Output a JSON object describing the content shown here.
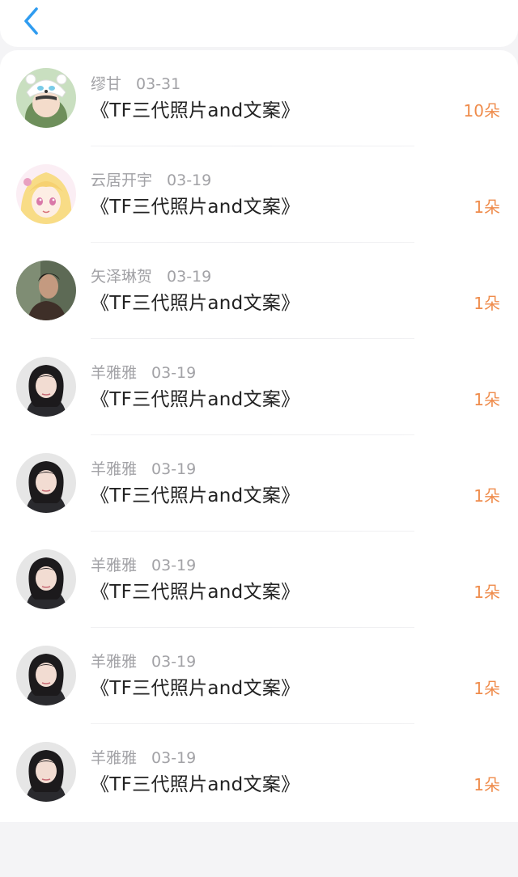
{
  "header": {
    "back_icon": "chevron-left-icon"
  },
  "colors": {
    "count": "#ef8c4c",
    "meta": "#a2a2a6",
    "back": "#2f9cf0"
  },
  "items": [
    {
      "name": "缪甘",
      "date": "03-31",
      "title": "《TF三代照片and文案》",
      "count": "10朵",
      "avatar": "sticker-avatar"
    },
    {
      "name": "云居开宇",
      "date": "03-19",
      "title": "《TF三代照片and文案》",
      "count": "1朵",
      "avatar": "anime-avatar"
    },
    {
      "name": "矢泽琳贺",
      "date": "03-19",
      "title": "《TF三代照片and文案》",
      "count": "1朵",
      "avatar": "photo-avatar"
    },
    {
      "name": "羊雅雅",
      "date": "03-19",
      "title": "《TF三代照片and文案》",
      "count": "1朵",
      "avatar": "photo-avatar"
    },
    {
      "name": "羊雅雅",
      "date": "03-19",
      "title": "《TF三代照片and文案》",
      "count": "1朵",
      "avatar": "photo-avatar"
    },
    {
      "name": "羊雅雅",
      "date": "03-19",
      "title": "《TF三代照片and文案》",
      "count": "1朵",
      "avatar": "photo-avatar"
    },
    {
      "name": "羊雅雅",
      "date": "03-19",
      "title": "《TF三代照片and文案》",
      "count": "1朵",
      "avatar": "photo-avatar"
    },
    {
      "name": "羊雅雅",
      "date": "03-19",
      "title": "《TF三代照片and文案》",
      "count": "1朵",
      "avatar": "photo-avatar"
    }
  ]
}
